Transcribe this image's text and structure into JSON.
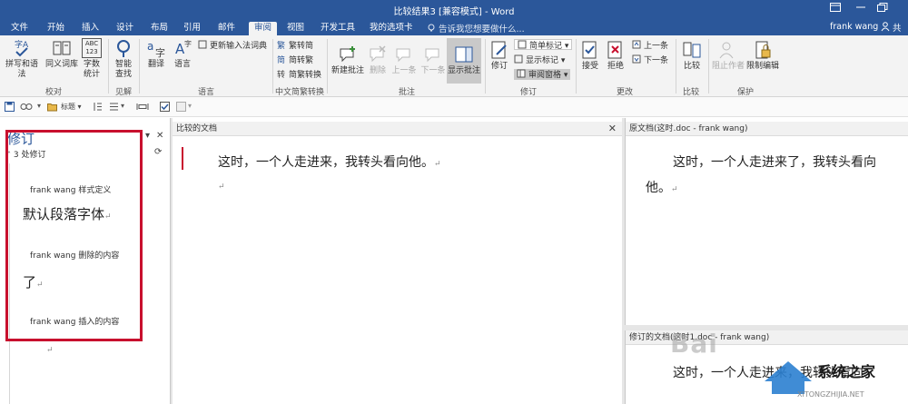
{
  "window": {
    "title": "比较结果3 [兼容模式] - Word",
    "controls": {
      "restore": "□",
      "maximize": "❐"
    }
  },
  "tabs": [
    "文件",
    "开始",
    "插入",
    "设计",
    "布局",
    "引用",
    "邮件",
    "审阅",
    "视图",
    "开发工具",
    "我的选项卡"
  ],
  "active_tab": "审阅",
  "tell_me": "告诉我您想要做什么...",
  "user": "frank wang",
  "share": "共享",
  "ribbon": {
    "proofing": {
      "label": "校对",
      "spelling": "拼写和语法",
      "thesaurus": "同义词库",
      "word_count_1": "字数",
      "word_count_2": "统计",
      "abc": "ABC",
      "num": "123"
    },
    "insights": {
      "label": "见解",
      "smart_1": "智能",
      "smart_2": "查找"
    },
    "language": {
      "label": "语言",
      "translate": "翻译",
      "language": "语言",
      "ime": "更新输入法词典"
    },
    "chinese": {
      "label": "中文简繁转换",
      "to_trad": "繁转简",
      "to_simp": "简转繁",
      "convert": "简繁转换"
    },
    "comments": {
      "label": "批注",
      "new": "新建批注",
      "delete": "删除",
      "prev": "上一条",
      "next": "下一条",
      "show": "显示批注"
    },
    "tracking": {
      "label": "修订",
      "track": "修订",
      "simple_markup": "简单标记",
      "show_markup": "显示标记",
      "review_pane": "审阅窗格"
    },
    "changes": {
      "label": "更改",
      "accept": "接受",
      "reject": "拒绝",
      "prev": "上一条",
      "next": "下一条"
    },
    "compare": {
      "label": "比较",
      "compare": "比较"
    },
    "protect": {
      "label": "保护",
      "block_authors": "阻止作者",
      "restrict": "限制编辑"
    }
  },
  "qat": {
    "style": "标题"
  },
  "revision_pane": {
    "title": "修订",
    "count": "3 处修订",
    "items": [
      {
        "author": "frank wang  样式定义",
        "text": "默认段落字体"
      },
      {
        "author": "frank wang  删除的内容",
        "text": "了"
      },
      {
        "author": "frank wang  插入的内容",
        "text": ""
      }
    ]
  },
  "compared_doc": {
    "header": "比较的文档",
    "line1": "这时，一个人走进来，我转头看向他。"
  },
  "original_doc": {
    "header": "原文档(这时.doc - frank wang)",
    "line1": "这时，一个人走进来了，我转头看向",
    "line2": "他。"
  },
  "revised_doc": {
    "header": "修订的文档(这时1.doc - frank wang)",
    "line1": "这时，一个人走进来，我转头看向"
  },
  "para_mark": "↵",
  "watermarks": {
    "baidu": "Bai",
    "site": "XITONGZHIJIA.NET",
    "brand": "系统之家"
  },
  "colors": {
    "accent": "#2b579a",
    "highlight": "#c8102e"
  }
}
